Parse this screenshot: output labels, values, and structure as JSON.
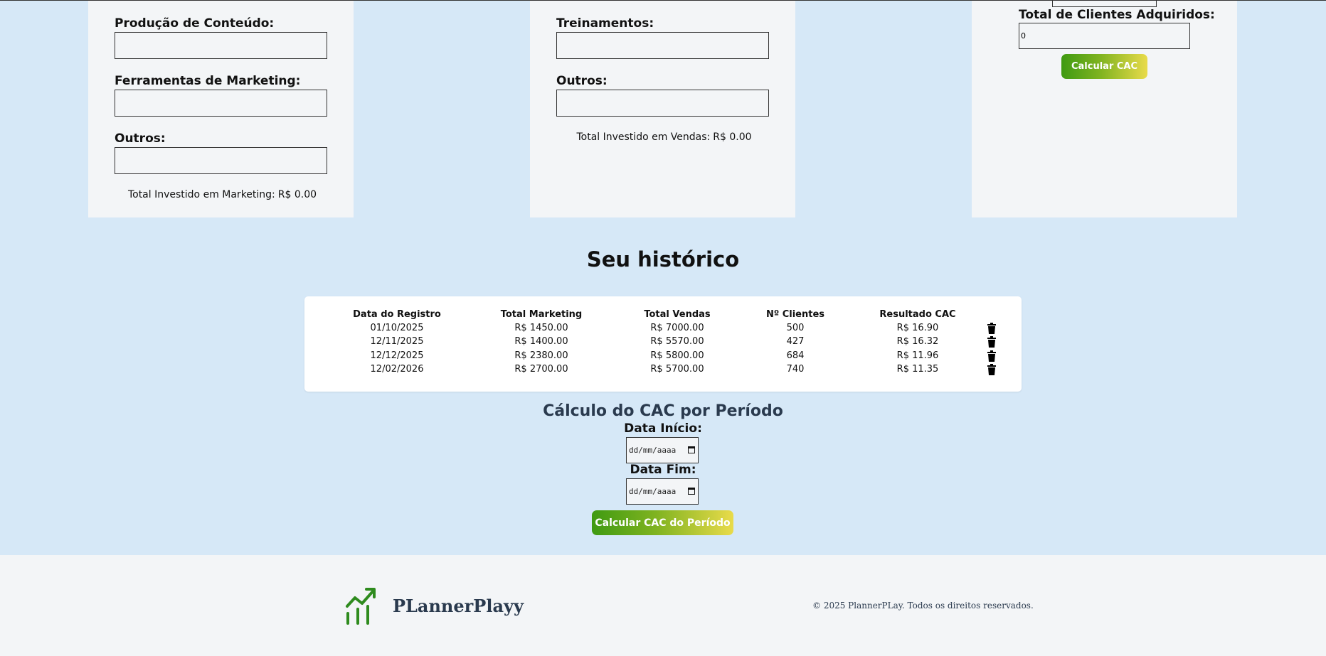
{
  "marketing": {
    "fields": [
      {
        "label": "Produção de Conteúdo:",
        "value": ""
      },
      {
        "label": "Ferramentas de Marketing:",
        "value": ""
      },
      {
        "label": "Outros:",
        "value": ""
      }
    ],
    "total_label": "Total Investido em Marketing:",
    "total_value": "R$ 0.00"
  },
  "vendas": {
    "fields": [
      {
        "label": "Treinamentos:",
        "value": ""
      },
      {
        "label": "Outros:",
        "value": ""
      }
    ],
    "total_label": "Total Investido em Vendas:",
    "total_value": "R$ 0.00"
  },
  "clientes": {
    "label": "Total de Clientes Adquiridos:",
    "value": "0",
    "button": "Calcular CAC"
  },
  "historico": {
    "title": "Seu histórico",
    "headers": [
      "Data do Registro",
      "Total Marketing",
      "Total Vendas",
      "Nº Clientes",
      "Resultado CAC"
    ],
    "rows": [
      [
        "01/10/2025",
        "R$ 1450.00",
        "R$ 7000.00",
        "500",
        "R$ 16.90"
      ],
      [
        "12/11/2025",
        "R$ 1400.00",
        "R$ 5570.00",
        "427",
        "R$ 16.32"
      ],
      [
        "12/12/2025",
        "R$ 2380.00",
        "R$ 5800.00",
        "684",
        "R$ 11.96"
      ],
      [
        "12/02/2026",
        "R$ 2700.00",
        "R$ 5700.00",
        "740",
        "R$ 11.35"
      ]
    ],
    "delete_icon": "trash-icon"
  },
  "periodo": {
    "title": "Cálculo do CAC por Período",
    "start_label": "Data Início:",
    "start_placeholder": "dd/mm/aaaa",
    "end_label": "Data Fim:",
    "end_placeholder": "dd/mm/aaaa",
    "button": "Calcular CAC do Período"
  },
  "footer": {
    "brand": "PLannerPlayy",
    "copyright": "© 2025 PlannerPLay. Todos os direitos reservados.",
    "logo_icon": "growth-chart-icon",
    "logo_color": "#2e8b1e"
  },
  "colors": {
    "background": "#d6e8f7",
    "card": "#f3f5f7",
    "button_gradient_start": "#3f9a12",
    "button_gradient_end": "#e9db4a"
  }
}
